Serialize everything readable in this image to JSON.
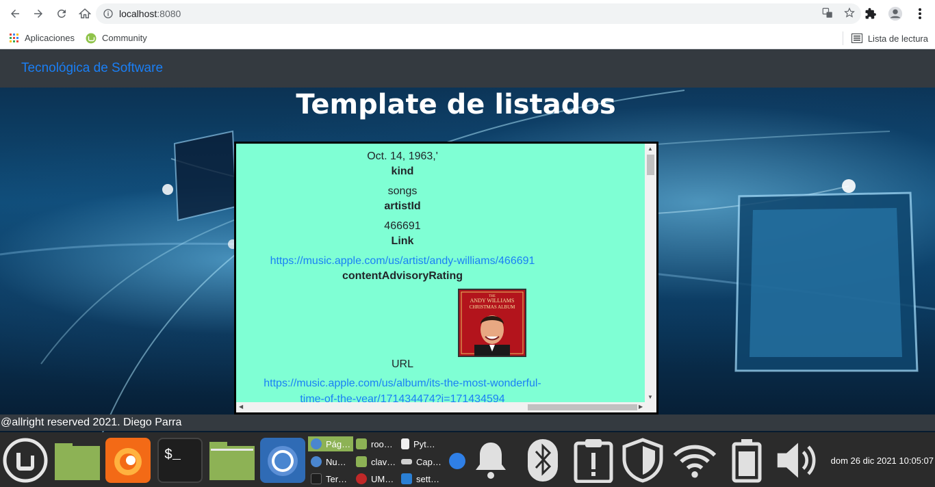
{
  "browser": {
    "url_host": "localhost",
    "url_port": ":8080",
    "bookmarks": [
      {
        "label": "Aplicaciones",
        "icon": "apps-grid-icon"
      },
      {
        "label": "Community",
        "icon": "mint-community-icon"
      }
    ],
    "reading_list_label": "Lista de lectura"
  },
  "page": {
    "brand": "Tecnológica de Software",
    "title": "Template de listados",
    "list": {
      "rows": [
        {
          "type": "value",
          "text": "Oct. 14, 1963,'"
        },
        {
          "type": "heading",
          "text": "kind"
        },
        {
          "type": "value",
          "text": "songs"
        },
        {
          "type": "heading",
          "text": "artistId"
        },
        {
          "type": "value",
          "text": "466691"
        },
        {
          "type": "heading",
          "text": "Link"
        },
        {
          "type": "link",
          "text": "https://music.apple.com/us/artist/andy-williams/466691"
        },
        {
          "type": "heading",
          "text": "contentAdvisoryRating"
        },
        {
          "type": "heading",
          "text": "URL"
        },
        {
          "type": "link",
          "text": "https://music.apple.com/us/album/its-the-most-wonderful-"
        },
        {
          "type": "link",
          "text": "time-of-the-year/171434474?i=171434594"
        }
      ],
      "album": {
        "line1": "THE",
        "line2": "ANDY WILLIAMS",
        "line3": "CHRISTMAS ALBUM"
      }
    },
    "footer": "@allright reserved 2021. Diego Parra"
  },
  "taskbar": {
    "windows": [
      {
        "label": "Pág…",
        "icon": "chrome-icon",
        "active": true
      },
      {
        "label": "roo…",
        "icon": "folder-icon"
      },
      {
        "label": "Pyt…",
        "icon": "document-icon"
      },
      {
        "label": "Nu…",
        "icon": "chrome-icon"
      },
      {
        "label": "clav…",
        "icon": "folder-icon"
      },
      {
        "label": "Cap…",
        "icon": "screenshot-icon"
      },
      {
        "label": "Ter…",
        "icon": "terminal-icon"
      },
      {
        "label": "UM…",
        "icon": "umbrello-icon"
      },
      {
        "label": "sett…",
        "icon": "vscode-icon"
      }
    ],
    "clock": "dom 26 dic 2021 10:05:07"
  }
}
